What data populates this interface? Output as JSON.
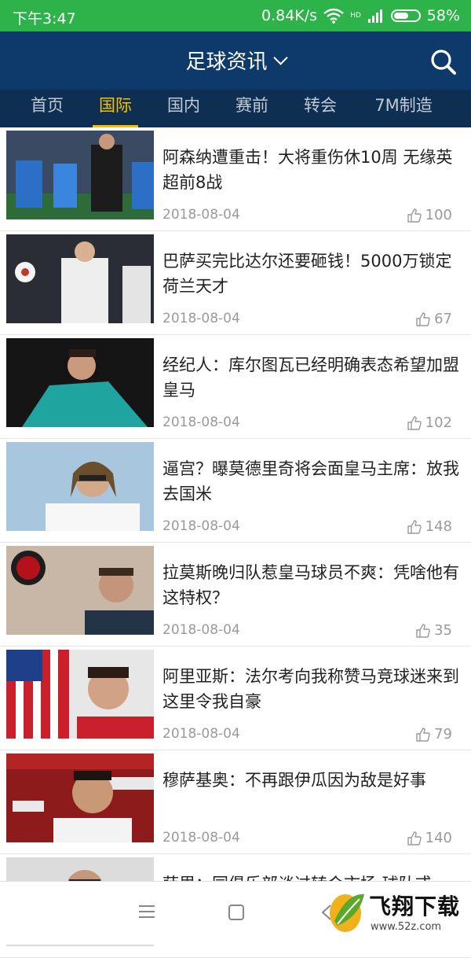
{
  "status_bar": {
    "time": "下午3:47",
    "network_speed": "0.84K/s",
    "signal_label": "HD",
    "battery": "58%"
  },
  "header": {
    "title": "足球资讯",
    "bg_color": "#0d3a6a"
  },
  "tabs": [
    {
      "label": "首页",
      "active": false
    },
    {
      "label": "国际",
      "active": true
    },
    {
      "label": "国内",
      "active": false
    },
    {
      "label": "赛前",
      "active": false
    },
    {
      "label": "转会",
      "active": false
    },
    {
      "label": "7M制造",
      "active": false
    }
  ],
  "accent_color": "#f5c000",
  "articles": [
    {
      "title": "阿森纳遭重击！大将重伤休10周 无缘英超前8战",
      "date": "2018-08-04",
      "likes": "100"
    },
    {
      "title": "巴萨买完比达尔还要砸钱！5000万锁定荷兰天才",
      "date": "2018-08-04",
      "likes": "67"
    },
    {
      "title": "经纪人：库尔图瓦已经明确表态希望加盟皇马",
      "date": "2018-08-04",
      "likes": "102"
    },
    {
      "title": "逼宫？曝莫德里奇将会面皇马主席：放我去国米",
      "date": "2018-08-04",
      "likes": "148"
    },
    {
      "title": "拉莫斯晚归队惹皇马球员不爽：凭啥他有这特权？",
      "date": "2018-08-04",
      "likes": "35"
    },
    {
      "title": "阿里亚斯：法尔考向我称赞马竞球迷来到这里令我自豪",
      "date": "2018-08-04",
      "likes": "79"
    },
    {
      "title": "穆萨基奥：不再跟伊瓜因为敌是好事",
      "date": "2018-08-04",
      "likes": "140"
    },
    {
      "title": "萨里：同俱乐部谈过转会市场 球队或",
      "date": "",
      "likes": ""
    }
  ],
  "watermark": {
    "brand": "飞翔下载",
    "url": "www.52z.com"
  }
}
